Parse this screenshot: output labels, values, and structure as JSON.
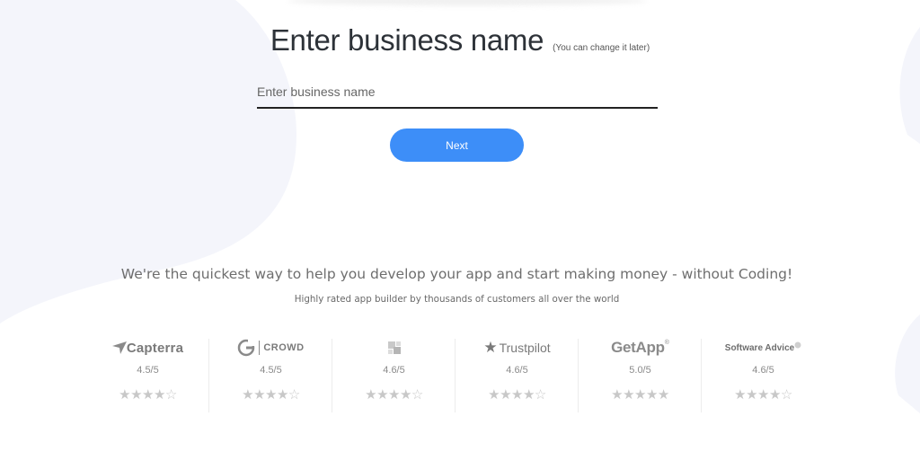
{
  "header": {
    "title": "Enter business name",
    "subtitle": "(You can change it later)"
  },
  "form": {
    "input_placeholder": "Enter business name",
    "input_value": "",
    "next_label": "Next"
  },
  "tagline": "We're the quickest way to help you develop your app and start making money - without Coding!",
  "subtagline": "Highly rated app builder by thousands of customers all over the world",
  "ratings": [
    {
      "name": "Capterra",
      "icon": "capterra-logo",
      "score": "4.5/5",
      "stars": 4.5
    },
    {
      "name": "CROWD",
      "icon": "g2-crowd-logo",
      "score": "4.5/5",
      "stars": 4.5
    },
    {
      "name": "",
      "icon": "generic-logo",
      "score": "4.6/5",
      "stars": 4.5
    },
    {
      "name": "Trustpilot",
      "icon": "trustpilot-logo",
      "score": "4.6/5",
      "stars": 4.5
    },
    {
      "name": "GetApp",
      "icon": "getapp-logo",
      "score": "5.0/5",
      "stars": 5
    },
    {
      "name": "Software Advice",
      "icon": "software-advice-logo",
      "score": "4.6/5",
      "stars": 4.5
    }
  ],
  "colors": {
    "accent": "#3d8ef8",
    "background_shape": "#f4f5fb"
  }
}
